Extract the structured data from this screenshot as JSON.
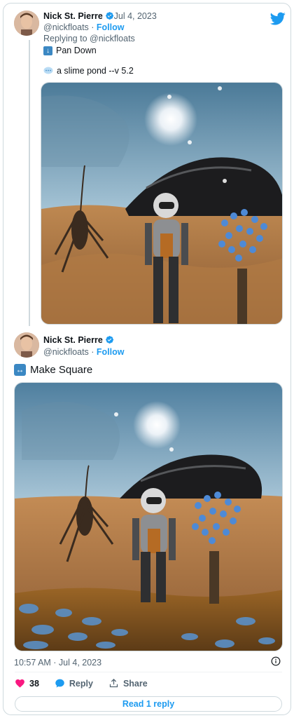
{
  "colors": {
    "accent": "#1d9bf0",
    "like": "#f91880",
    "muted": "#536471"
  },
  "tweet1": {
    "name": "Nick St. Pierre",
    "date": "· Jul 4, 2023",
    "handle": "@nickfloats",
    "separator": " · ",
    "follow": "Follow",
    "replying": "Replying to @nickfloats",
    "command1": "Pan Down",
    "command2": "a slime pond --v 5.2",
    "image_alt": "astronaut with insect creature and blue flower plant in a desert near a dark dome"
  },
  "tweet2": {
    "name": "Nick St. Pierre",
    "handle": "@nickfloats",
    "separator": " · ",
    "follow": "Follow",
    "text": "Make Square",
    "image_alt": "square version of the astronaut desert scene with a slime pond of blue blobs",
    "timestamp": "10:57 AM · Jul 4, 2023",
    "likes": "38",
    "reply_label": "Reply",
    "share_label": "Share",
    "read_replies": "Read 1 reply"
  },
  "icons": [
    "twitter-bird-icon",
    "verified-badge-icon",
    "arrow-down-icon",
    "speech-bubble-icon",
    "left-right-arrow-icon",
    "info-icon",
    "heart-icon",
    "reply-bubble-icon",
    "share-icon"
  ]
}
